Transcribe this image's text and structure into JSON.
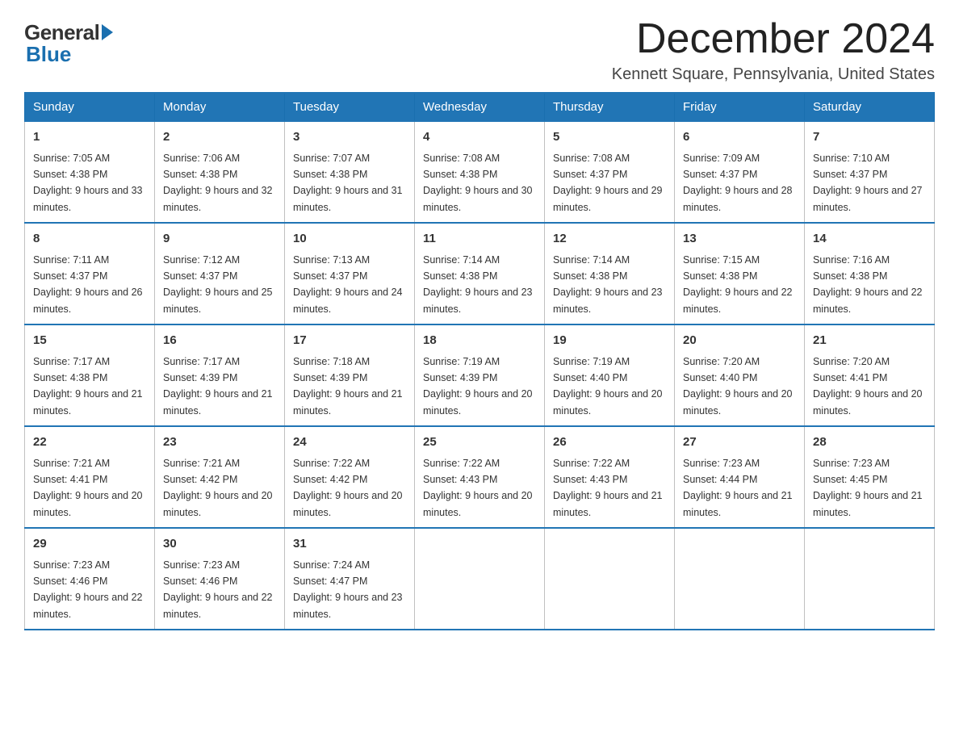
{
  "logo": {
    "general": "General",
    "blue": "Blue"
  },
  "title": "December 2024",
  "location": "Kennett Square, Pennsylvania, United States",
  "days_of_week": [
    "Sunday",
    "Monday",
    "Tuesday",
    "Wednesday",
    "Thursday",
    "Friday",
    "Saturday"
  ],
  "weeks": [
    [
      {
        "day": "1",
        "sunrise": "7:05 AM",
        "sunset": "4:38 PM",
        "daylight": "9 hours and 33 minutes."
      },
      {
        "day": "2",
        "sunrise": "7:06 AM",
        "sunset": "4:38 PM",
        "daylight": "9 hours and 32 minutes."
      },
      {
        "day": "3",
        "sunrise": "7:07 AM",
        "sunset": "4:38 PM",
        "daylight": "9 hours and 31 minutes."
      },
      {
        "day": "4",
        "sunrise": "7:08 AM",
        "sunset": "4:38 PM",
        "daylight": "9 hours and 30 minutes."
      },
      {
        "day": "5",
        "sunrise": "7:08 AM",
        "sunset": "4:37 PM",
        "daylight": "9 hours and 29 minutes."
      },
      {
        "day": "6",
        "sunrise": "7:09 AM",
        "sunset": "4:37 PM",
        "daylight": "9 hours and 28 minutes."
      },
      {
        "day": "7",
        "sunrise": "7:10 AM",
        "sunset": "4:37 PM",
        "daylight": "9 hours and 27 minutes."
      }
    ],
    [
      {
        "day": "8",
        "sunrise": "7:11 AM",
        "sunset": "4:37 PM",
        "daylight": "9 hours and 26 minutes."
      },
      {
        "day": "9",
        "sunrise": "7:12 AM",
        "sunset": "4:37 PM",
        "daylight": "9 hours and 25 minutes."
      },
      {
        "day": "10",
        "sunrise": "7:13 AM",
        "sunset": "4:37 PM",
        "daylight": "9 hours and 24 minutes."
      },
      {
        "day": "11",
        "sunrise": "7:14 AM",
        "sunset": "4:38 PM",
        "daylight": "9 hours and 23 minutes."
      },
      {
        "day": "12",
        "sunrise": "7:14 AM",
        "sunset": "4:38 PM",
        "daylight": "9 hours and 23 minutes."
      },
      {
        "day": "13",
        "sunrise": "7:15 AM",
        "sunset": "4:38 PM",
        "daylight": "9 hours and 22 minutes."
      },
      {
        "day": "14",
        "sunrise": "7:16 AM",
        "sunset": "4:38 PM",
        "daylight": "9 hours and 22 minutes."
      }
    ],
    [
      {
        "day": "15",
        "sunrise": "7:17 AM",
        "sunset": "4:38 PM",
        "daylight": "9 hours and 21 minutes."
      },
      {
        "day": "16",
        "sunrise": "7:17 AM",
        "sunset": "4:39 PM",
        "daylight": "9 hours and 21 minutes."
      },
      {
        "day": "17",
        "sunrise": "7:18 AM",
        "sunset": "4:39 PM",
        "daylight": "9 hours and 21 minutes."
      },
      {
        "day": "18",
        "sunrise": "7:19 AM",
        "sunset": "4:39 PM",
        "daylight": "9 hours and 20 minutes."
      },
      {
        "day": "19",
        "sunrise": "7:19 AM",
        "sunset": "4:40 PM",
        "daylight": "9 hours and 20 minutes."
      },
      {
        "day": "20",
        "sunrise": "7:20 AM",
        "sunset": "4:40 PM",
        "daylight": "9 hours and 20 minutes."
      },
      {
        "day": "21",
        "sunrise": "7:20 AM",
        "sunset": "4:41 PM",
        "daylight": "9 hours and 20 minutes."
      }
    ],
    [
      {
        "day": "22",
        "sunrise": "7:21 AM",
        "sunset": "4:41 PM",
        "daylight": "9 hours and 20 minutes."
      },
      {
        "day": "23",
        "sunrise": "7:21 AM",
        "sunset": "4:42 PM",
        "daylight": "9 hours and 20 minutes."
      },
      {
        "day": "24",
        "sunrise": "7:22 AM",
        "sunset": "4:42 PM",
        "daylight": "9 hours and 20 minutes."
      },
      {
        "day": "25",
        "sunrise": "7:22 AM",
        "sunset": "4:43 PM",
        "daylight": "9 hours and 20 minutes."
      },
      {
        "day": "26",
        "sunrise": "7:22 AM",
        "sunset": "4:43 PM",
        "daylight": "9 hours and 21 minutes."
      },
      {
        "day": "27",
        "sunrise": "7:23 AM",
        "sunset": "4:44 PM",
        "daylight": "9 hours and 21 minutes."
      },
      {
        "day": "28",
        "sunrise": "7:23 AM",
        "sunset": "4:45 PM",
        "daylight": "9 hours and 21 minutes."
      }
    ],
    [
      {
        "day": "29",
        "sunrise": "7:23 AM",
        "sunset": "4:46 PM",
        "daylight": "9 hours and 22 minutes."
      },
      {
        "day": "30",
        "sunrise": "7:23 AM",
        "sunset": "4:46 PM",
        "daylight": "9 hours and 22 minutes."
      },
      {
        "day": "31",
        "sunrise": "7:24 AM",
        "sunset": "4:47 PM",
        "daylight": "9 hours and 23 minutes."
      },
      null,
      null,
      null,
      null
    ]
  ]
}
